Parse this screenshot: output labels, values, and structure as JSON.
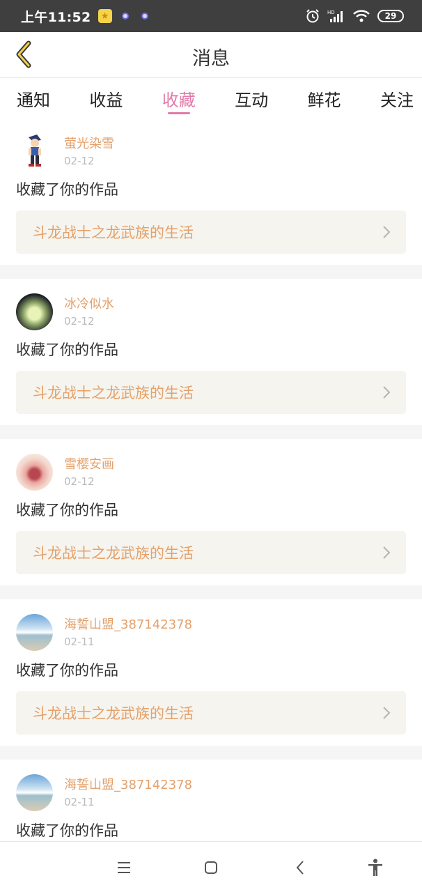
{
  "status_bar": {
    "time": "上午11:52",
    "battery": "29"
  },
  "header": {
    "title": "消息"
  },
  "tabs": [
    {
      "label": "通知",
      "active": false
    },
    {
      "label": "收益",
      "active": false
    },
    {
      "label": "收藏",
      "active": true
    },
    {
      "label": "互动",
      "active": false
    },
    {
      "label": "鲜花",
      "active": false
    },
    {
      "label": "关注",
      "active": false
    }
  ],
  "notifications": [
    {
      "user": "萤光染雪",
      "date": "02-12",
      "action": "收藏了你的作品",
      "work": "斗龙战士之龙武族的生活"
    },
    {
      "user": "冰冷似水",
      "date": "02-12",
      "action": "收藏了你的作品",
      "work": "斗龙战士之龙武族的生活"
    },
    {
      "user": "雪樱安画",
      "date": "02-12",
      "action": "收藏了你的作品",
      "work": "斗龙战士之龙武族的生活"
    },
    {
      "user": "海誓山盟_387142378",
      "date": "02-11",
      "action": "收藏了你的作品",
      "work": "斗龙战士之龙武族的生活"
    },
    {
      "user": "海誓山盟_387142378",
      "date": "02-11",
      "action": "收藏了你的作品",
      "work": ""
    }
  ],
  "colors": {
    "accent": "#e27aa8",
    "username": "#e3a16c",
    "status_bar": "#3f3f3f"
  }
}
